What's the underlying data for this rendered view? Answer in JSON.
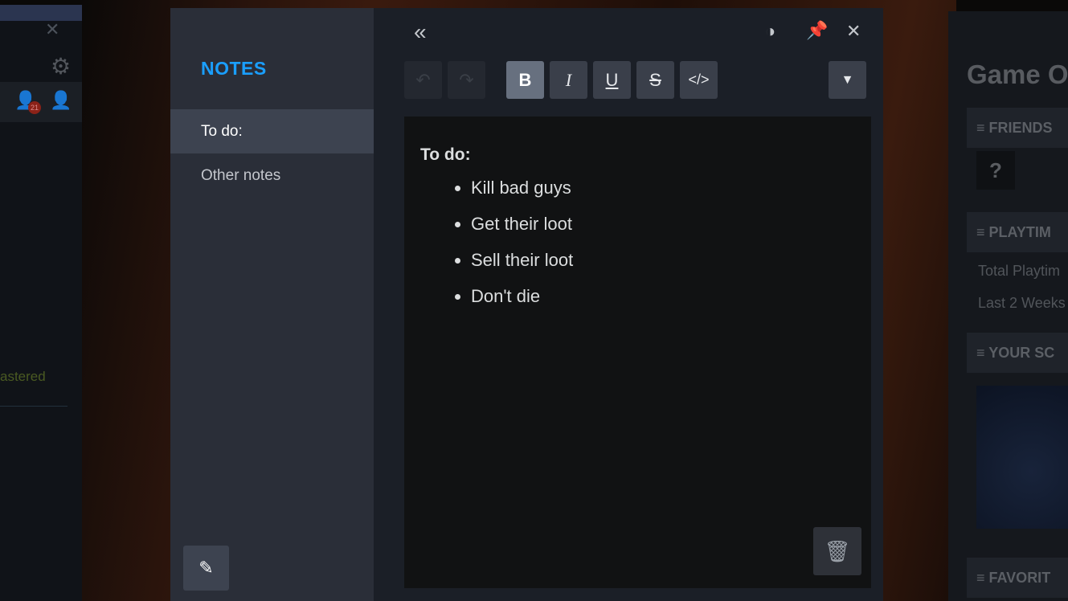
{
  "left_panel": {
    "badge_count": "21",
    "partial_text": "astered"
  },
  "notes": {
    "title": "NOTES",
    "items": [
      {
        "label": "To do:",
        "active": true
      },
      {
        "label": "Other notes",
        "active": false
      }
    ]
  },
  "toolbar": {
    "bold": "B",
    "italic": "I",
    "underline": "U",
    "strike": "S",
    "code": "</>"
  },
  "editor": {
    "heading": "To do:",
    "bullets": [
      "Kill bad guys",
      "Get their loot",
      "Sell their loot",
      "Don't die"
    ]
  },
  "right_panel": {
    "title": "Game O",
    "sections": [
      "FRIENDS",
      "PLAYTIM",
      "YOUR SC",
      "FAVORIT"
    ],
    "unknown": "?",
    "playtime_rows": [
      "Total Playtim",
      "Last 2 Weeks"
    ]
  },
  "colors": {
    "accent": "#1a9fff"
  }
}
